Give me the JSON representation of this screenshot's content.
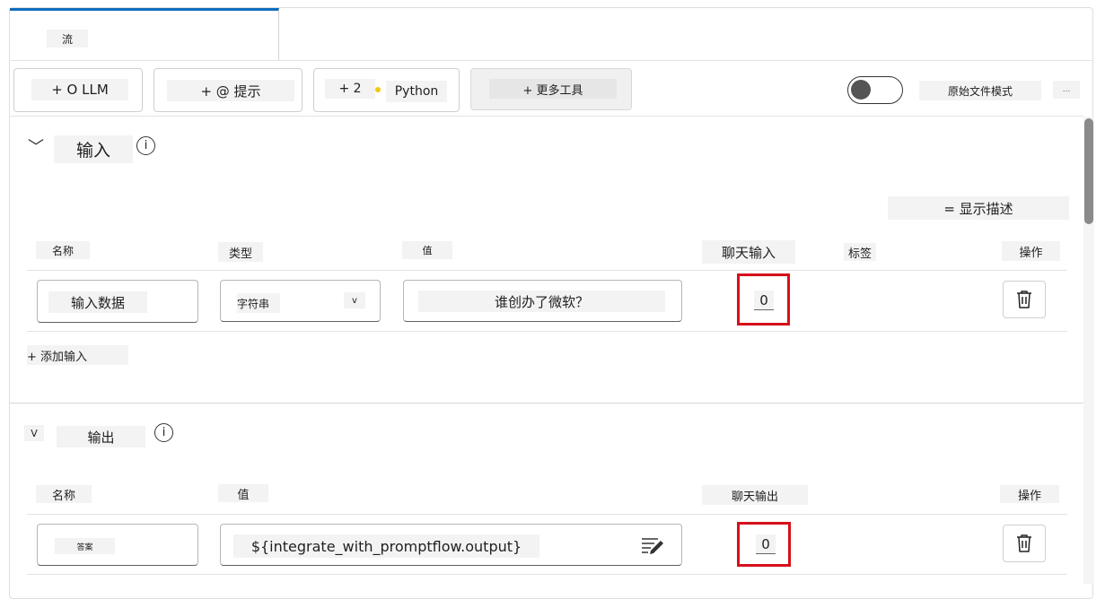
{
  "tab": {
    "label": "流"
  },
  "toolbar": {
    "llm_label": "+ O LLM",
    "prompt_label": "+ @ 提示",
    "python_prefix": "+ 2",
    "python_label": "Python",
    "more_tools_label": "+ 更多工具",
    "raw_file_mode_label": "原始文件模式",
    "more_label": "..."
  },
  "inputs_section": {
    "collapse_glyph": "﹀",
    "title": "输入",
    "info_glyph": "i",
    "show_description_label": "= 显示描述",
    "columns": [
      "名称",
      "类型",
      "值",
      "聊天输入",
      "标签",
      "操作"
    ],
    "row": {
      "name": "输入数据",
      "type": "字符串",
      "type_chevron": "v",
      "value": "谁创办了微软？",
      "chat_input_value": "0"
    },
    "add_input_label": "+ 添加输入"
  },
  "outputs_section": {
    "collapse_glyph": "V",
    "title": "输出",
    "info_glyph": "i",
    "columns": [
      "名称",
      "值",
      "聊天输出",
      "操作"
    ],
    "row": {
      "name": "答案",
      "value": "${integrate_with_promptflow.output}",
      "chat_output_value": "0"
    }
  },
  "colors": {
    "accent": "#0f6cbd",
    "highlight": "#d6101a"
  }
}
